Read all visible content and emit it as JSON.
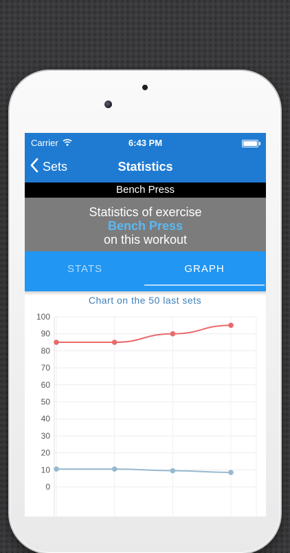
{
  "status_bar": {
    "carrier": "Carrier",
    "time": "6:43 PM",
    "wifi_icon": "wifi-icon",
    "battery_icon": "battery-icon"
  },
  "nav": {
    "back_label": "Sets",
    "title": "Statistics",
    "back_icon": "chevron-left-icon"
  },
  "exercise_bar": {
    "name": "Bench Press"
  },
  "description": {
    "line1": "Statistics of exercise",
    "exercise": "Bench Press",
    "line3": "on this workout"
  },
  "tabs": [
    {
      "label": "STATS",
      "active": false
    },
    {
      "label": "GRAPH",
      "active": true
    }
  ],
  "colors": {
    "header": "#1f7bd1",
    "tabs": "#2196f3",
    "series_top": "#e96a6a",
    "series_bottom": "#97b9cf"
  },
  "chart_data": {
    "type": "line",
    "title": "Chart on the 50 last sets",
    "ylim": [
      0,
      100
    ],
    "yticks": [
      "100",
      "90",
      "80",
      "70",
      "60",
      "50",
      "40",
      "30",
      "20",
      "10",
      "0"
    ],
    "x": [
      1,
      2,
      3,
      4
    ],
    "grid": true,
    "series": [
      {
        "values": [
          85,
          85,
          90,
          95
        ],
        "color": "#e96a6a"
      },
      {
        "values": [
          10.5,
          10.5,
          9.5,
          8.5
        ],
        "color": "#97b9cf"
      }
    ]
  }
}
